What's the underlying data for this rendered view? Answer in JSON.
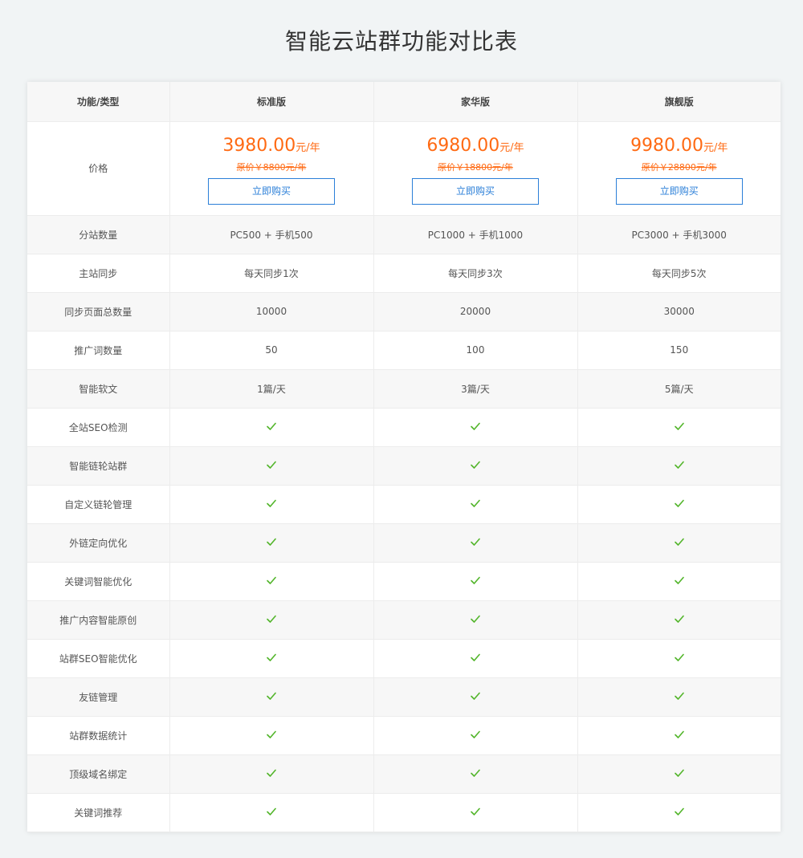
{
  "title": "智能云站群功能对比表",
  "header": [
    "功能/类型",
    "标准版",
    "家华版",
    "旗舰版"
  ],
  "price": {
    "label": "价格",
    "plans": [
      {
        "price": "3980.00",
        "unit": "元/年",
        "original": "原价￥8800元/年",
        "buy": "立即购买"
      },
      {
        "price": "6980.00",
        "unit": "元/年",
        "original": "原价￥18800元/年",
        "buy": "立即购买"
      },
      {
        "price": "9980.00",
        "unit": "元/年",
        "original": "原价￥28800元/年",
        "buy": "立即购买"
      }
    ]
  },
  "rows": [
    {
      "label": "分站数量",
      "values": [
        "PC500 + 手机500",
        "PC1000 + 手机1000",
        "PC3000 + 手机3000"
      ]
    },
    {
      "label": "主站同步",
      "values": [
        "每天同步1次",
        "每天同步3次",
        "每天同步5次"
      ]
    },
    {
      "label": "同步页面总数量",
      "values": [
        "10000",
        "20000",
        "30000"
      ]
    },
    {
      "label": "推广词数量",
      "values": [
        "50",
        "100",
        "150"
      ]
    },
    {
      "label": "智能软文",
      "values": [
        "1篇/天",
        "3篇/天",
        "5篇/天"
      ]
    },
    {
      "label": "全站SEO检测",
      "check": true
    },
    {
      "label": "智能链轮站群",
      "check": true
    },
    {
      "label": "自定义链轮管理",
      "check": true
    },
    {
      "label": "外链定向优化",
      "check": true
    },
    {
      "label": "关键词智能优化",
      "check": true
    },
    {
      "label": "推广内容智能原创",
      "check": true
    },
    {
      "label": "站群SEO智能优化",
      "check": true
    },
    {
      "label": "友链管理",
      "check": true
    },
    {
      "label": "站群数据统计",
      "check": true
    },
    {
      "label": "顶级域名绑定",
      "check": true
    },
    {
      "label": "关键词推荐",
      "check": true
    }
  ],
  "colors": {
    "accent": "#ff6a13",
    "button": "#2b7fd8",
    "check": "#52b52a"
  },
  "icons": {
    "check": "check-icon"
  }
}
